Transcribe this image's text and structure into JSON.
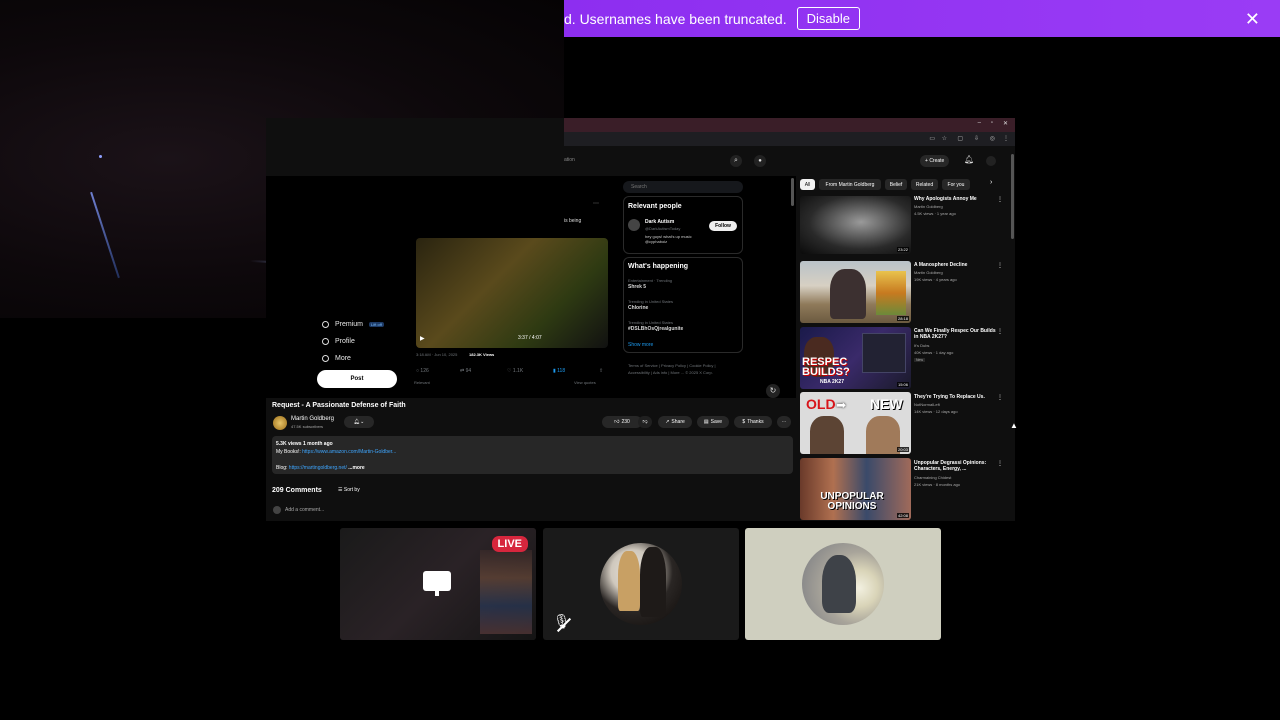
{
  "banner": {
    "text": "d. Usernames have been truncated.",
    "disable_label": "Disable",
    "close_icon": "close-icon",
    "color": "#9a3cf5"
  },
  "x_sidebar": {
    "items": [
      {
        "label": "Premium",
        "badge": "Lift off"
      },
      {
        "label": "Profile"
      },
      {
        "label": "More"
      }
    ],
    "post_label": "Post"
  },
  "x_right": {
    "search_placeholder": "Search",
    "relevant_title": "Relevant people",
    "person_name": "Dark Autism",
    "person_handle": "@DarkAutismToday",
    "person_bio": "hey guys! what's up music @cyphaboiz",
    "follow_label": "Follow",
    "happening_title": "What's happening",
    "trends": [
      {
        "context": "Entertainment · Trending",
        "name": "Shrek 5"
      },
      {
        "context": "Trending in United States",
        "name": "Chlorine"
      },
      {
        "context": "Trending in United States",
        "name": "#DSLBhOsQjrealgunite"
      }
    ],
    "show_more": "Show more",
    "footer": "Terms of Service | Privacy Policy | Cookie Policy | Accessibility | Ads info | More ... © 2025 X Corp."
  },
  "tweet": {
    "snippet": "is being",
    "timestamp": "3:18 AM · Jun 10, 2025",
    "views": "182.3K Views",
    "video_time": "3:37 / 4:07",
    "stats": {
      "replies": "126",
      "reposts": "94",
      "likes": "1.1K",
      "bookmarks": "118"
    },
    "relevant": "Relevant",
    "view_quotes": "View quotes"
  },
  "video": {
    "title": "Request - A Passionate Defense of Faith",
    "channel": "Martin Goldberg",
    "subscribers": "47.5K subscribers",
    "likes": "230",
    "share_label": "Share",
    "save_label": "Save",
    "thanks_label": "Thanks",
    "views_line": "5.3K views  1 month ago",
    "books_label": "My Books!:",
    "books_link": "https://www.amazon.com/Martin-Goldber...",
    "blog_label": "Blog:",
    "blog_link": "https://martingoldberg.net/",
    "more_label": "...more",
    "comments_count": "209 Comments",
    "sort_label": "Sort by",
    "add_comment": "Add a comment..."
  },
  "youtube_header": {
    "create_label": "Create",
    "search_suffix": "ation"
  },
  "chips": [
    "All",
    "From Martin Goldberg",
    "Belief",
    "Related",
    "For you"
  ],
  "recommendations": [
    {
      "title": "Why Apologists Annoy Me",
      "channel": "Martin Goldberg",
      "meta": "4.5K views · 1 year ago",
      "duration": "23:22"
    },
    {
      "title": "A Manosphere Decline",
      "channel": "Martin Goldberg",
      "meta": "19K views · 4 years ago",
      "duration": "28:18"
    },
    {
      "title": "Can We Finally Respec Our Builds in NBA 2K27?",
      "channel": "It's Dubs",
      "meta": "40K views · 1 day ago",
      "badge": "New",
      "duration": "15:06"
    },
    {
      "title": "They're Trying To Replace Us.",
      "channel": "NotNormalLeft",
      "meta": "14K views · 12 days ago",
      "duration": "20:03"
    },
    {
      "title": "Unpopular Degrassi Opinions: Characters, Energy, ...",
      "channel": "Charmaining Chidest",
      "meta": "21K views · 8 months ago",
      "duration": "42:08"
    }
  ],
  "thumb_text": {
    "respec": "RESPEC BUILDS?",
    "nba": "NBA 2K27",
    "old": "OLD",
    "new": "NEW",
    "unpopular": "UNPOPULAR OPINIONS"
  },
  "tiles": {
    "live_label": "LIVE",
    "screen_icon": "monitor-icon",
    "mute_icon": "mic-off-icon"
  }
}
